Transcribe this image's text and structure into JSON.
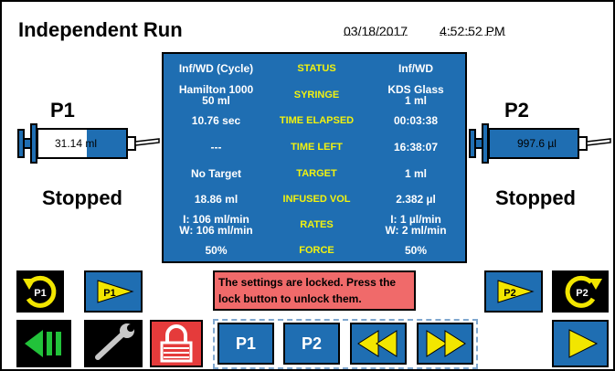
{
  "header": {
    "title": "Independent Run",
    "date": "03/18/2017",
    "time": "4:52:52 PM"
  },
  "status": {
    "rows": [
      {
        "p1": "Inf/WD (Cycle)",
        "label": "STATUS",
        "p2": "Inf/WD"
      },
      {
        "p1": [
          "Hamilton 1000",
          "50 ml"
        ],
        "label": "SYRINGE",
        "p2": [
          "KDS Glass",
          "1 ml"
        ]
      },
      {
        "p1": "10.76 sec",
        "label": "TIME ELAPSED",
        "p2": "00:03:38"
      },
      {
        "p1": "---",
        "label": "TIME LEFT",
        "p2": "16:38:07"
      },
      {
        "p1": "No Target",
        "label": "TARGET",
        "p2": "1 ml"
      },
      {
        "p1": "18.86 ml",
        "label": "INFUSED VOL",
        "p2": "2.382 µl"
      },
      {
        "p1": [
          "I: 106 ml/min",
          "W: 106 ml/min"
        ],
        "label": "RATES",
        "p2": [
          "I: 1 µl/min",
          "W: 2 ml/min"
        ]
      },
      {
        "p1": "50%",
        "label": "FORCE",
        "p2": "50%"
      }
    ]
  },
  "pump1": {
    "label": "P1",
    "volume": "31.14 ml",
    "state": "Stopped",
    "fill_fraction": 0.45
  },
  "pump2": {
    "label": "P2",
    "volume": "997.6 µl",
    "state": "Stopped",
    "fill_fraction": 1.0
  },
  "buttons": {
    "p1_cycle": "P1",
    "p1_run": "P1",
    "p2_run": "P2",
    "p2_cycle": "P2",
    "select_p1": "P1",
    "select_p2": "P2"
  },
  "lock_message": "The settings are locked. Press the lock button to unlock them.",
  "colors": {
    "panel_blue": "#1f6eb2",
    "label_yellow": "#f2f20f",
    "lock_red": "#e53b3b",
    "arrow_yellow": "#f2e600",
    "green": "#22c23a"
  }
}
